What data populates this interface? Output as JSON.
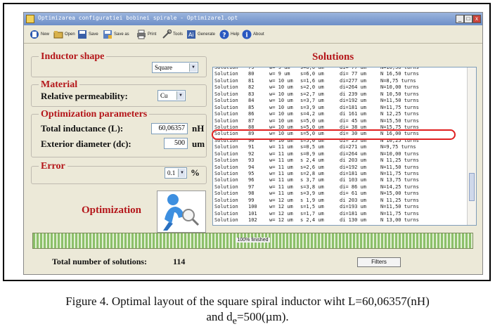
{
  "window": {
    "title": "Optimizarea configuratiei bobinei spirale - Optimizare1.opt",
    "controls": {
      "minimize": "_",
      "maximize": "□",
      "close": "x"
    }
  },
  "toolbar": {
    "items": [
      {
        "label": "New",
        "icon": "new-file-icon"
      },
      {
        "label": "Open",
        "icon": "open-folder-icon"
      },
      {
        "label": "Save",
        "icon": "save-disk-icon"
      },
      {
        "label": "Save as",
        "icon": "save-as-icon"
      },
      {
        "label": "Print",
        "icon": "printer-icon"
      },
      {
        "label": "Tools",
        "icon": "wrench-icon"
      },
      {
        "label": "Generate",
        "icon": "generate-icon"
      },
      {
        "label": "Help",
        "icon": "help-icon"
      },
      {
        "label": "About",
        "icon": "info-icon"
      }
    ]
  },
  "inductor_shape": {
    "title": "Inductor shape",
    "value": "Square"
  },
  "material": {
    "title": "Material",
    "label": "Relative permeability:",
    "value": "Cu"
  },
  "optimization_parameters": {
    "title": "Optimization parameters",
    "inductance_label": "Total inductance (L):",
    "inductance_value": "60,06357",
    "inductance_unit": "nH",
    "diameter_label": "Exterior diameter (dc):",
    "diameter_value": "500",
    "diameter_unit": "um"
  },
  "error": {
    "title": "Error",
    "value": "0.1",
    "unit": "%"
  },
  "optimization": {
    "label": "Optimization",
    "icon": "person-magnifier-icon"
  },
  "solutions": {
    "title": "Solutions",
    "rows": [
      {
        "name": "Solution",
        "n": "79",
        "w": "w= 9 um",
        "s": "s=6,0 um",
        "di": "di= 77 um",
        "N": "N=16,50 turns"
      },
      {
        "name": "Solution",
        "n": "80",
        "w": "w= 9 um",
        "s": "s=6,0 um",
        "di": "di= 77 um",
        "N": "N 16,50 turns"
      },
      {
        "name": "Solution",
        "n": "81",
        "w": "w= 10 um",
        "s": "s=1,6 um",
        "di": "di=277 um",
        "N": "N=8,75 turns"
      },
      {
        "name": "Solution",
        "n": "82",
        "w": "w= 10 um",
        "s": "s=2,0 um",
        "di": "di=264 um",
        "N": "N=10,00 turns"
      },
      {
        "name": "Solution",
        "n": "83",
        "w": "w= 10 um",
        "s": "s=2,7 um",
        "di": "di 239 um",
        "N": "N 10,50 turns"
      },
      {
        "name": "Solution",
        "n": "84",
        "w": "w= 10 um",
        "s": "s=3,7 um",
        "di": "di=192 um",
        "N": "N=11,50 turns"
      },
      {
        "name": "Solution",
        "n": "85",
        "w": "w= 10 um",
        "s": "s=3,9 um",
        "di": "di=181 um",
        "N": "N=11,75 turns"
      },
      {
        "name": "Solution",
        "n": "86",
        "w": "w= 10 um",
        "s": "s=4,2 um",
        "di": "di 161 um",
        "N": "N 12,25 turns"
      },
      {
        "name": "Solution",
        "n": "87",
        "w": "w= 10 um",
        "s": "s=5,0 um",
        "di": "di= 45 um",
        "N": "N=15,50 turns"
      },
      {
        "name": "Solution",
        "n": "88",
        "w": "w= 10 um",
        "s": "s=5,0 um",
        "di": "di= 38 um",
        "N": "N=15,75 turns"
      },
      {
        "name": "Solution",
        "n": "89",
        "w": "w= 10 um",
        "s": "s=5,0 um",
        "di": "di= 30 um",
        "N": "N 16,00 turns"
      },
      {
        "name": "Solution",
        "n": "90",
        "w": "w= 10 um",
        "s": "s=5,0 um",
        "di": "di= 25 um",
        "N": "N 16,25 turns"
      },
      {
        "name": "Solution",
        "n": "91",
        "w": "w= 11 um",
        "s": "s=0,5 um",
        "di": "di=271 um",
        "N": "N=9,75 turns"
      },
      {
        "name": "Solution",
        "n": "92",
        "w": "w= 11 um",
        "s": "s=0,9 um",
        "di": "di=264 um",
        "N": "N=10,00 turns"
      },
      {
        "name": "Solution",
        "n": "93",
        "w": "w= 11 um",
        "s": "s 2,4 um",
        "di": "di 203 um",
        "N": "N 11,25 turns"
      },
      {
        "name": "Solution",
        "n": "94",
        "w": "w= 11 um",
        "s": "s=2,6 um",
        "di": "di=192 um",
        "N": "N=11,50 turns"
      },
      {
        "name": "Solution",
        "n": "95",
        "w": "w= 11 um",
        "s": "s=2,8 um",
        "di": "di=181 um",
        "N": "N=11,75 turns"
      },
      {
        "name": "Solution",
        "n": "96",
        "w": "w= 11 um",
        "s": "s 3,7 um",
        "di": "di 103 um",
        "N": "N 13,75 turns"
      },
      {
        "name": "Solution",
        "n": "97",
        "w": "w= 11 um",
        "s": "s=3,8 um",
        "di": "di= 86 um",
        "N": "N=14,25 turns"
      },
      {
        "name": "Solution",
        "n": "98",
        "w": "w= 11 um",
        "s": "s=3,9 um",
        "di": "di= 61 um",
        "N": "N=15,00 turns"
      },
      {
        "name": "Solution",
        "n": "99",
        "w": "w= 12 um",
        "s": "s 1,9 um",
        "di": "di 203 um",
        "N": "N 11,25 turns"
      },
      {
        "name": "Solution",
        "n": "100",
        "w": "w= 12 um",
        "s": "s=1,5 um",
        "di": "di=193 um",
        "N": "N=11,50 turns"
      },
      {
        "name": "Solution",
        "n": "101",
        "w": "w= 12 um",
        "s": "s=1,7 um",
        "di": "di=181 um",
        "N": "N=11,75 turns"
      },
      {
        "name": "Solution",
        "n": "102",
        "w": "w= 12 um",
        "s": "s 2,4 um",
        "di": "di 130 um",
        "N": "N 13,00 turns"
      }
    ]
  },
  "progress": {
    "text": "100% finished",
    "fraction": 1.0
  },
  "total": {
    "label": "Total number of solutions:",
    "value": "114"
  },
  "filters_button": "Filters",
  "caption": {
    "line1": "Figure 4.    Optimal layout of the square spiral inductor wiht L=60,06357(nH)",
    "line2_pre": "and d",
    "line2_sub": "e",
    "line2_post": "=500(µm)."
  },
  "colors": {
    "accent_red": "#b4161a",
    "highlight": "#e02020",
    "progress_green": "#8cc06a"
  }
}
